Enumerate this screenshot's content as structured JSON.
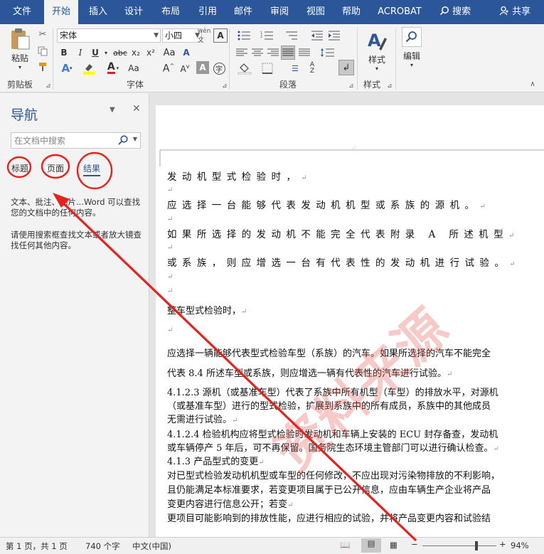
{
  "menu": {
    "items": [
      "文件",
      "开始",
      "插入",
      "设计",
      "布局",
      "引用",
      "邮件",
      "审阅",
      "视图",
      "帮助",
      "ACROBAT"
    ],
    "active": "开始",
    "search_label": "搜索",
    "share_label": "共享"
  },
  "ribbon": {
    "clipboard": {
      "paste_label": "粘贴",
      "group_label": "剪贴板"
    },
    "font": {
      "font_name": "宋体",
      "font_size": "小四",
      "group_label": "字体",
      "buttons": [
        "B",
        "I",
        "U",
        "abc",
        "x₂",
        "x²"
      ]
    },
    "paragraph": {
      "group_label": "段落"
    },
    "styles": {
      "label": "样式",
      "group_label": "样式"
    },
    "editing": {
      "label": "编辑"
    }
  },
  "nav": {
    "title": "导航",
    "search_placeholder": "在文档中搜索",
    "tabs": [
      "标题",
      "页面",
      "结果"
    ],
    "active_tab": "结果",
    "text1": "文本、批注、图片...Word 可以查找您的文档中的任何内容。",
    "text2": "请使用搜索框查找文本或者放大镜查找任何其他内容。"
  },
  "document": {
    "lines": [
      "发动机型式检验时，",
      "应选择一台能够代表发动机机型或系族的源机。",
      "如果所选择的发动机不能完全代表附录 A 所述机型",
      "或系族，则应增选一台有代表性的发动机进行试验。",
      "整车型式检验时，",
      "应选择一辆能够代表型式检验车型（系族）的汽车。如果所选择的汽车不能完全",
      "代表 8.4 所述车型或系族，则应增选一辆有代表性的汽车进行试验。",
      "4.1.2.3 源机（或基准车型）代表了系族中所有机型（车型）的排放水平，对源机",
      "（或基准车型）进行的型式检验，扩展到系族中的所有成员，系族中的其他成员",
      "无需进行试验。",
      "4.1.2.4 检验机构应将型式检验时发动机和车辆上安装的 ECU 封存备查，发动机",
      "或车辆停产 5 年后，可不再保留。国务院生态环境主管部门可以进行确认检查。",
      "4.1.3 产品型式的变更",
      "对已型式检验发动机机型或车型的任何修改，不应出现对污染物排放的不利影响，",
      "且仍能满足本标准要求，若变更项目属于已公开信息，应由车辆生产企业将产品",
      "变更内容进行信息公开；若变",
      "更项目可能影响到的排放性能，应进行相应的试验，并将产品变更内容和试验结"
    ],
    "watermark": "资料来源"
  },
  "status": {
    "page": "第 1 页，共 1 页",
    "words": "740 个字",
    "language": "中文(中国)",
    "zoom": "94%"
  },
  "colors": {
    "accent": "#2b579a",
    "annotation": "#e8221b"
  }
}
